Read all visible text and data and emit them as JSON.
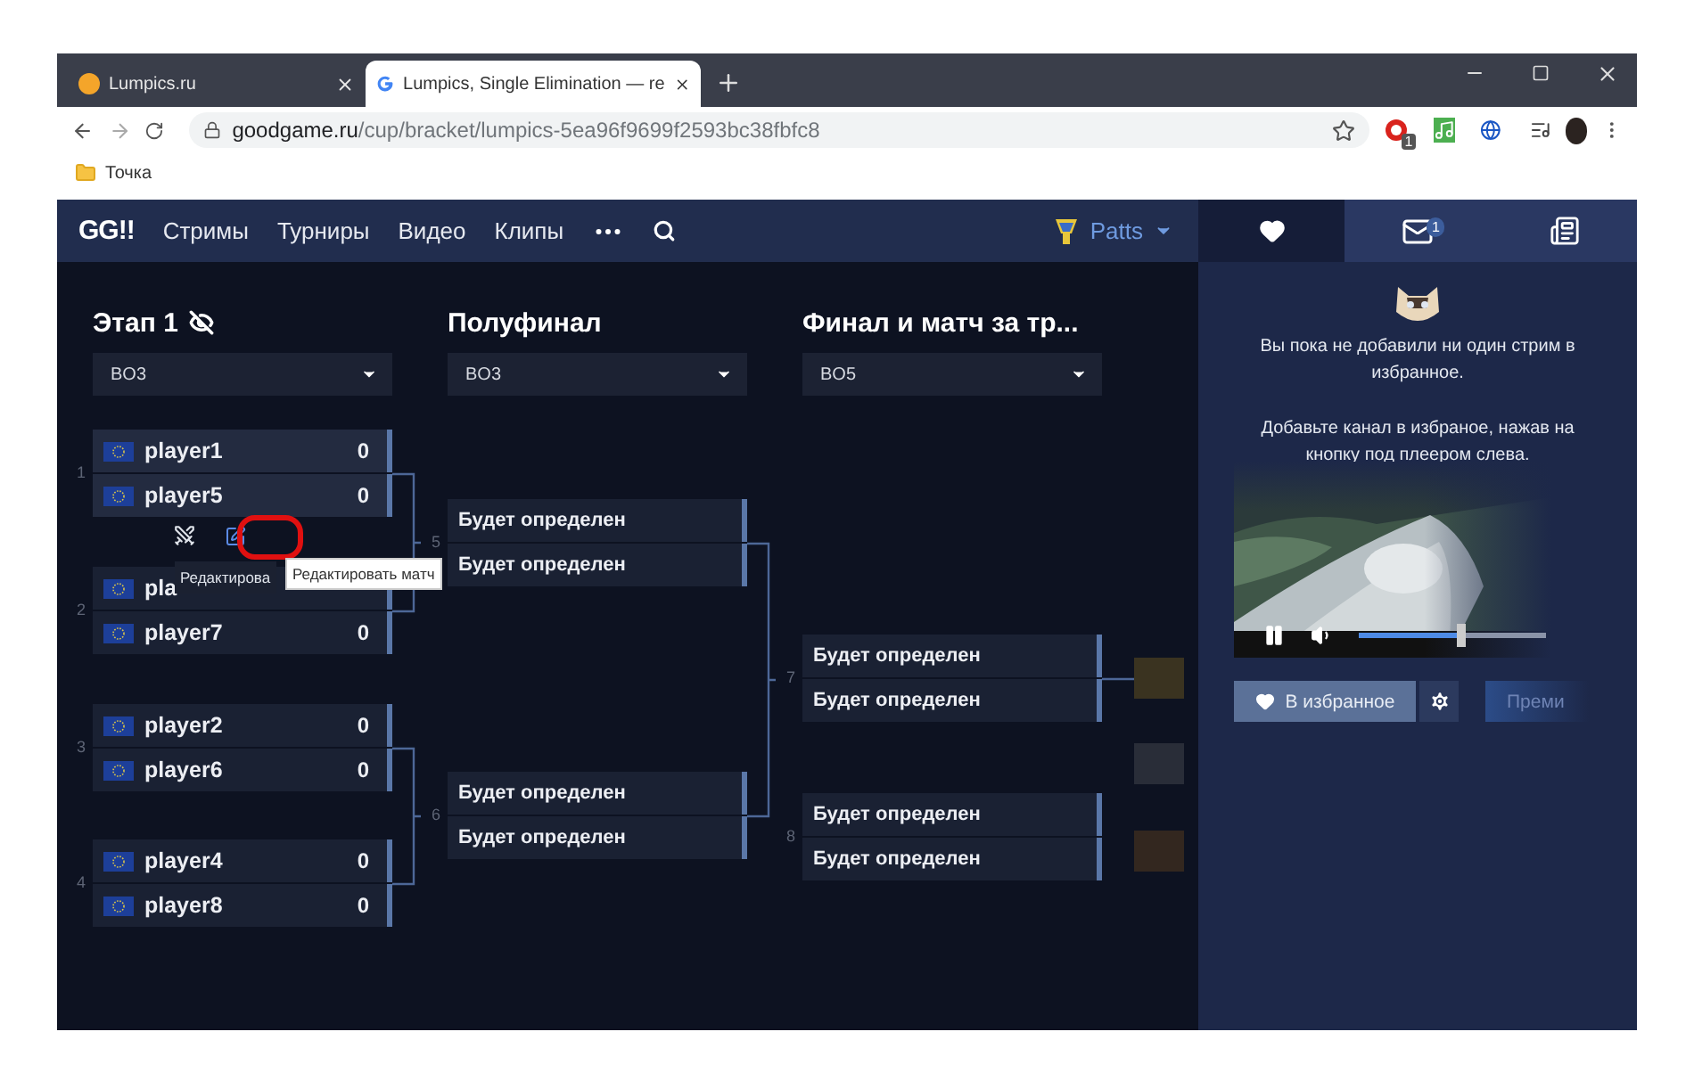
{
  "browser": {
    "tabs": [
      {
        "title": "Lumpics.ru",
        "selected": false
      },
      {
        "title": "Lumpics, Single Elimination — re",
        "selected": true
      }
    ],
    "url": {
      "host": "goodgame.ru",
      "path": "/cup/bracket/lumpics-5ea96f9699f2593bc38fbfc8"
    },
    "extension_badge": "1",
    "bookmarks": [
      "Точка"
    ]
  },
  "site": {
    "logo": "GG!!",
    "nav": [
      "Стримы",
      "Турниры",
      "Видео",
      "Клипы"
    ],
    "user": "Patts"
  },
  "rounds": [
    {
      "title": "Этап 1",
      "hidden_icon": true,
      "format": "BO3",
      "matches": [
        {
          "number": "1",
          "hovered": true,
          "players": [
            {
              "name": "player1",
              "flag": true,
              "score": "0"
            },
            {
              "name": "player5",
              "flag": true,
              "score": "0"
            }
          ]
        },
        {
          "number": "2",
          "hovered": false,
          "players": [
            {
              "name": "pla",
              "flag": true
            },
            {
              "name": "player7",
              "flag": true,
              "score": "0"
            }
          ]
        },
        {
          "number": "3",
          "hovered": false,
          "players": [
            {
              "name": "player2",
              "flag": true,
              "score": "0"
            },
            {
              "name": "player6",
              "flag": true,
              "score": "0"
            }
          ]
        },
        {
          "number": "4",
          "hovered": false,
          "players": [
            {
              "name": "player4",
              "flag": true,
              "score": "0"
            },
            {
              "name": "player8",
              "flag": true,
              "score": "0"
            }
          ]
        }
      ]
    },
    {
      "title": "Полуфинал",
      "format": "BO3",
      "matches": [
        {
          "number": "5",
          "hovered": false,
          "players": [
            {
              "name": "Будет определен"
            },
            {
              "name": "Будет определен"
            }
          ]
        },
        {
          "number": "6",
          "hovered": false,
          "players": [
            {
              "name": "Будет определен"
            },
            {
              "name": "Будет определен"
            }
          ]
        }
      ]
    },
    {
      "title": "Финал и матч за тр...",
      "format": "BO5",
      "matches": [
        {
          "number": "7",
          "hovered": false,
          "players": [
            {
              "name": "Будет определен"
            },
            {
              "name": "Будет определен"
            }
          ]
        },
        {
          "number": "8",
          "hovered": false,
          "players": [
            {
              "name": "Будет определен"
            },
            {
              "name": "Будет определен"
            }
          ]
        }
      ]
    }
  ],
  "places": [
    {
      "color": "#3a3320"
    },
    {
      "color": "#292d38"
    },
    {
      "color": "#33271f"
    }
  ],
  "tooltips": [
    {
      "text": "Редактирова",
      "kind": "dark"
    },
    {
      "text": "Редактировать матч",
      "kind": "light"
    }
  ],
  "sidebar": {
    "tabs": [
      {
        "selected": true
      },
      {
        "badge": "1",
        "selected": false
      },
      {
        "selected": false
      }
    ],
    "messages": [
      "Вы пока не добавили ни один стрим в избранное.",
      "Добавьте канал в избраное, нажав на кнопку под плеером слева."
    ],
    "player": {
      "playing": true,
      "volume": {
        "level": 0.54
      }
    },
    "favorite_button": "В избранное",
    "premium_button": "Преми"
  }
}
